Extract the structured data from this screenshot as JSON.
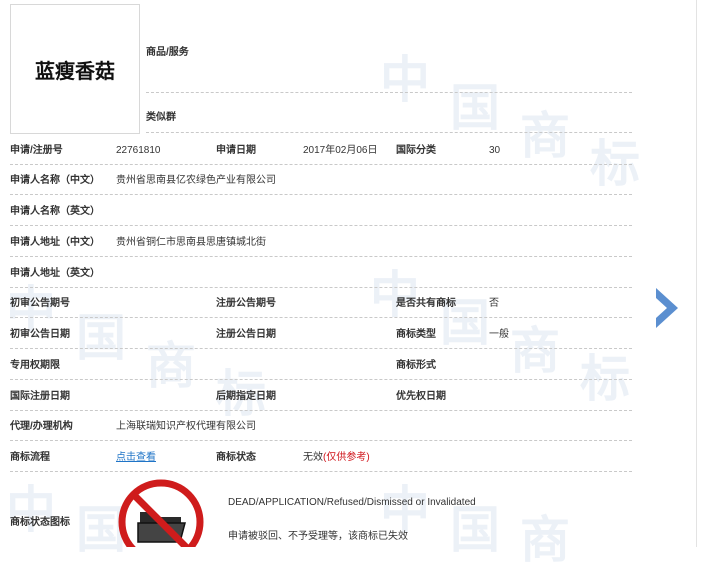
{
  "trademark": {
    "name_image_text": "蓝瘦香菇"
  },
  "header": {
    "goods_label": "商品/服务",
    "similar_group_label": "类似群"
  },
  "fields": {
    "reg_no_label": "申请/注册号",
    "reg_no": "22761810",
    "apply_date_label": "申请日期",
    "apply_date": "2017年02月06日",
    "intl_class_label": "国际分类",
    "intl_class": "30",
    "applicant_cn_label": "申请人名称（中文）",
    "applicant_cn": "贵州省思南县亿农绿色产业有限公司",
    "applicant_en_label": "申请人名称（英文）",
    "address_cn_label": "申请人地址（中文）",
    "address_cn": "贵州省铜仁市思南县思唐镇城北街",
    "address_en_label": "申请人地址（英文）",
    "prelim_no_label": "初审公告期号",
    "reg_notice_no_label": "注册公告期号",
    "shared_label": "是否共有商标",
    "shared": "否",
    "prelim_date_label": "初审公告日期",
    "reg_notice_date_label": "注册公告日期",
    "tm_type_label": "商标类型",
    "tm_type": "一般",
    "exclusive_label": "专用权期限",
    "tm_form_label": "商标形式",
    "intl_reg_date_label": "国际注册日期",
    "later_date_label": "后期指定日期",
    "priority_date_label": "优先权日期",
    "agent_label": "代理/办理机构",
    "agent": "上海联瑞知识产权代理有限公司",
    "process_label": "商标流程",
    "process_link": "点击查看",
    "status_label": "商标状态",
    "status": "无效",
    "status_note": "(仅供参考)",
    "status_icon_label": "商标状态图标",
    "status_en": "DEAD/APPLICATION/Refused/Dismissed or Invalidated",
    "status_cn": "申请被驳回、不予受理等，该商标已失效"
  },
  "watermark": {
    "chars": [
      "中",
      "国",
      "商",
      "标"
    ]
  },
  "colors": {
    "link": "#1f74c7",
    "warn": "#d0151b",
    "arrow": "#5b8fd0",
    "watermark": "#c8d7e8"
  },
  "icons": {
    "status_icon": "folder-prohibited-icon",
    "next": "chevron-right-icon"
  }
}
